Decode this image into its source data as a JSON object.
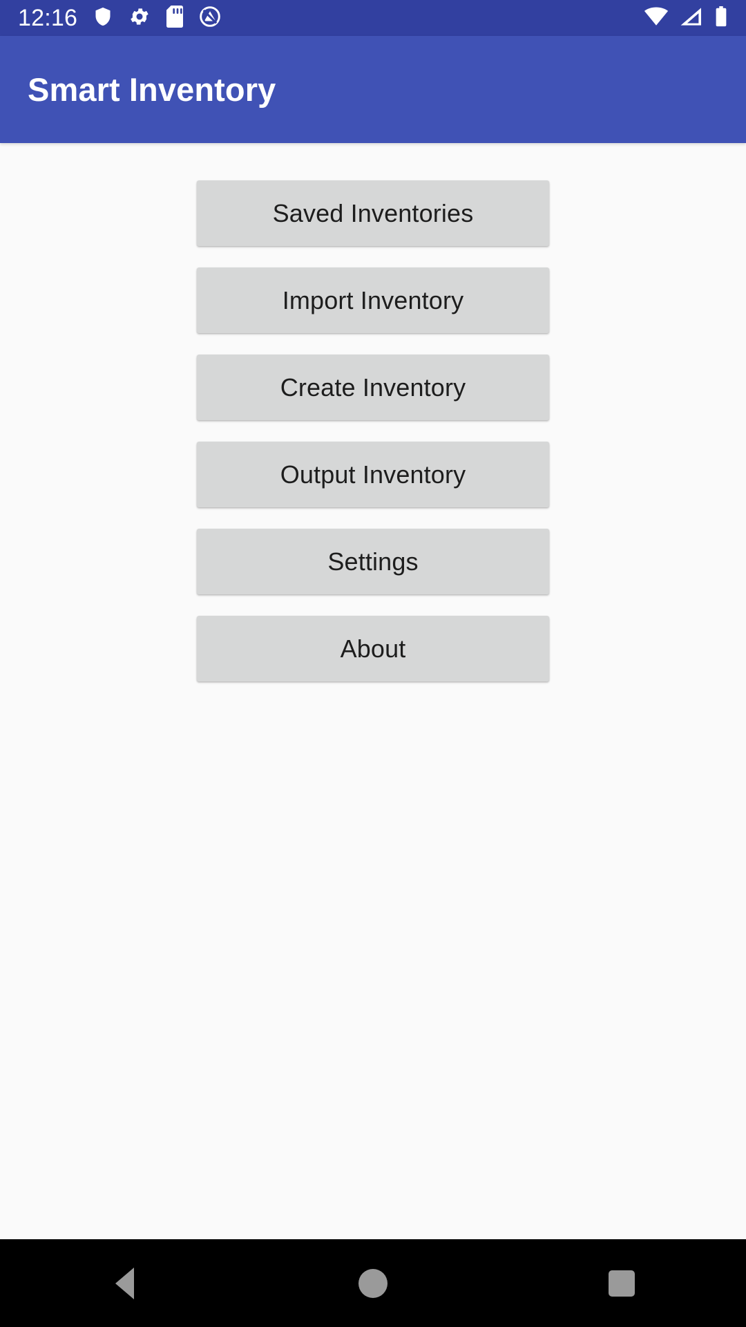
{
  "status_bar": {
    "clock": "12:16",
    "background_color": "#3240a0",
    "left_icons": [
      {
        "name": "shield-icon",
        "label": "shield"
      },
      {
        "name": "gear-icon",
        "label": "settings"
      },
      {
        "name": "sd-card-icon",
        "label": "sd card"
      },
      {
        "name": "no-sound-icon",
        "label": "silent mode"
      }
    ],
    "right_icons": [
      {
        "name": "wifi-icon",
        "label": "wifi full"
      },
      {
        "name": "cellular-signal-icon",
        "label": "cellular signal"
      },
      {
        "name": "battery-icon",
        "label": "battery full"
      }
    ]
  },
  "app_bar": {
    "title": "Smart Inventory",
    "background_color": "#4052b5",
    "text_color": "#ffffff"
  },
  "main": {
    "background_color": "#fafafa",
    "button_color": "#d6d7d7",
    "button_text_color": "#1d1d1d",
    "buttons": [
      {
        "id": "saved-inventories",
        "label": "Saved Inventories"
      },
      {
        "id": "import-inventory",
        "label": "Import Inventory"
      },
      {
        "id": "create-inventory",
        "label": "Create Inventory"
      },
      {
        "id": "output-inventory",
        "label": "Output Inventory"
      },
      {
        "id": "settings",
        "label": "Settings"
      },
      {
        "id": "about",
        "label": "About"
      }
    ]
  },
  "nav_bar": {
    "background_color": "#000000",
    "icon_color": "#9a9a9a",
    "buttons": [
      {
        "id": "back",
        "name": "back-icon"
      },
      {
        "id": "home",
        "name": "home-icon"
      },
      {
        "id": "recents",
        "name": "recents-icon"
      }
    ]
  }
}
